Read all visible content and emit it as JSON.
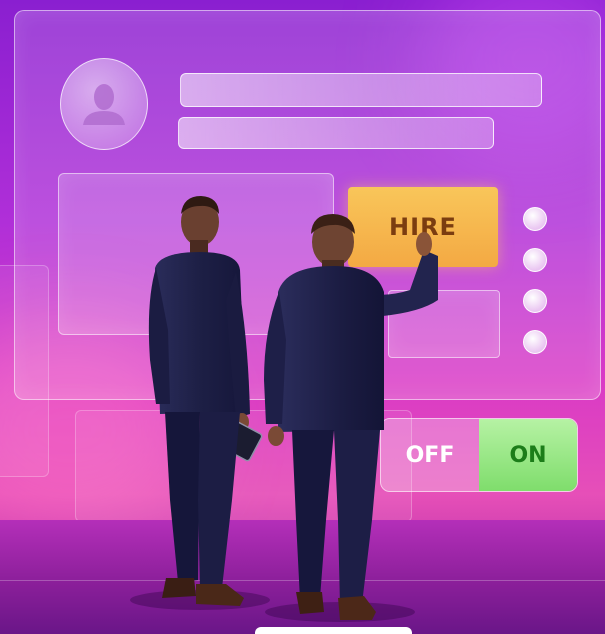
{
  "scene": {
    "description_free": true,
    "colors": {
      "background_top": "#8a1fd0",
      "background_bottom": "#e64fb8",
      "hire_button": "#f4ab45",
      "hire_text": "#7b3d10",
      "on_switch": "#84de70",
      "on_text": "#1c7d19",
      "off_text": "#ffffff",
      "suit": "#1d1f45"
    }
  },
  "ui": {
    "hire_label": "HIRE",
    "toggle": {
      "off_label": "OFF",
      "on_label": "ON",
      "state": "on"
    },
    "radio_count": 4
  },
  "icons": {
    "avatar": "user-silhouette-icon"
  }
}
